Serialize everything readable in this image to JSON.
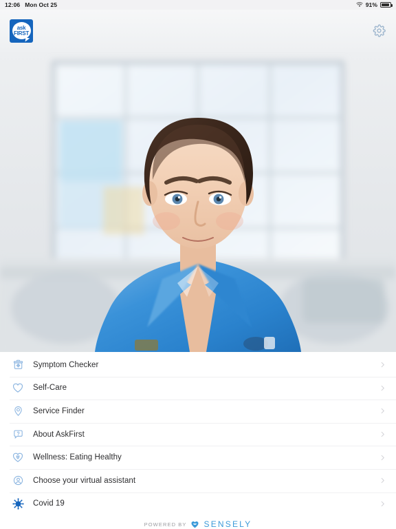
{
  "status_bar": {
    "time": "12:06",
    "date": "Mon Oct 25",
    "battery_percent": "91%",
    "wifi_icon": "wifi-icon",
    "battery_icon": "battery-icon"
  },
  "header": {
    "logo_line1": "ask",
    "logo_line2": "FIRST",
    "logo_name": "askfirst-logo",
    "settings_icon": "gear-icon",
    "brand_color": "#1565bd"
  },
  "hero": {
    "alt": "Virtual assistant nurse in blue uniform",
    "name": "hero-avatar-photo"
  },
  "menu": {
    "items": [
      {
        "label": "Symptom Checker",
        "icon": "medical-bag-icon",
        "name": "menu-item-symptom-checker"
      },
      {
        "label": "Self-Care",
        "icon": "heart-icon",
        "name": "menu-item-self-care"
      },
      {
        "label": "Service Finder",
        "icon": "map-pin-icon",
        "name": "menu-item-service-finder"
      },
      {
        "label": "About AskFirst",
        "icon": "question-bubble-icon",
        "name": "menu-item-about-askfirst"
      },
      {
        "label": "Wellness: Eating Healthy",
        "icon": "heart-cup-icon",
        "name": "menu-item-wellness-eating-healthy"
      },
      {
        "label": "Choose your virtual assistant",
        "icon": "person-circle-icon",
        "name": "menu-item-choose-virtual-assistant"
      },
      {
        "label": "Covid 19",
        "icon": "virus-icon",
        "name": "menu-item-covid-19"
      }
    ],
    "chevron_icon": "chevron-right-icon",
    "icon_color": "#8ab4e0",
    "accent_color": "#1565bd"
  },
  "footer": {
    "powered_by": "POWERED BY",
    "brand": "SENSELY",
    "logo_icon": "sensely-heart-icon",
    "brand_color": "#3b9ad9"
  }
}
